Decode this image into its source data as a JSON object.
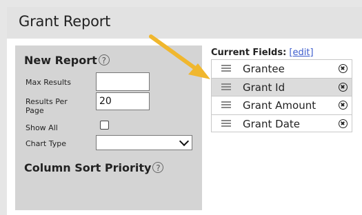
{
  "page": {
    "title": "Grant Report"
  },
  "new_report": {
    "heading": "New Report",
    "help_glyph": "?",
    "max_results": {
      "label": "Max Results",
      "value": ""
    },
    "results_per_page": {
      "label": "Results Per Page",
      "value": "20"
    },
    "show_all": {
      "label": "Show All",
      "checked": false
    },
    "chart_type": {
      "label": "Chart Type",
      "selected": ""
    }
  },
  "column_sort": {
    "heading": "Column Sort Priority",
    "help_glyph": "?"
  },
  "current_fields": {
    "label": "Current Fields:",
    "edit_link": "[edit]",
    "items": [
      {
        "name": "Grantee",
        "highlighted": false
      },
      {
        "name": "Grant Id",
        "highlighted": true
      },
      {
        "name": "Grant Amount",
        "highlighted": false
      },
      {
        "name": "Grant Date",
        "highlighted": false
      }
    ]
  },
  "colors": {
    "arrow": "#f0b72e",
    "link": "#3b5bcc",
    "panel": "#d4d4d4"
  }
}
